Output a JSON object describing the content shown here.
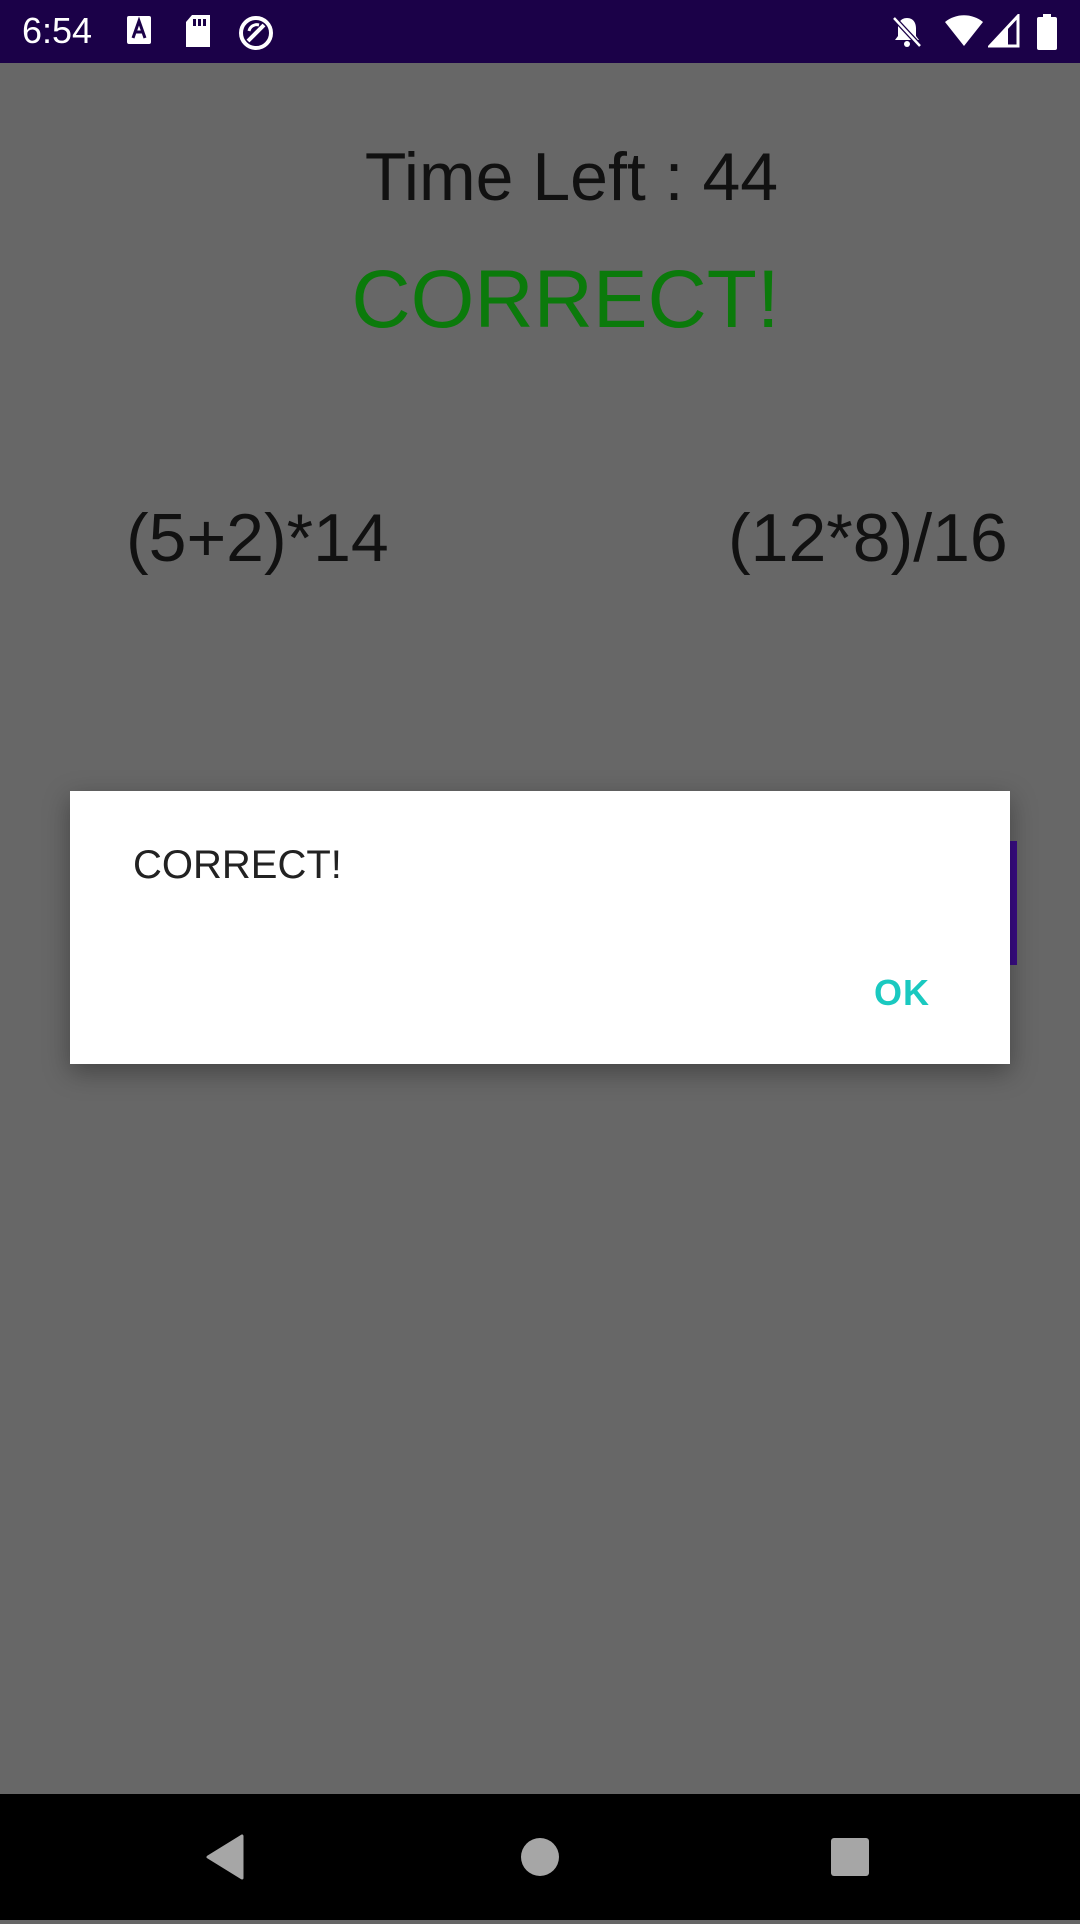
{
  "status_bar": {
    "time": "6:54",
    "icons": [
      "font-a-icon",
      "sd-card-icon",
      "sync-icon",
      "notifications-off-icon",
      "wifi-icon",
      "cell-signal-icon",
      "battery-icon"
    ]
  },
  "game": {
    "timer_text": "Time Left : 44",
    "result_text": "CORRECT!",
    "result_color": "#0b7a0b",
    "expressions": {
      "left": "(5+2)*14",
      "right": "(12*8)/16"
    }
  },
  "dialog": {
    "message": "CORRECT!",
    "ok_label": "OK",
    "accent_color": "#1ac9c0"
  },
  "nav_bar": {
    "icons": [
      "back-icon",
      "home-icon",
      "recents-icon"
    ]
  }
}
